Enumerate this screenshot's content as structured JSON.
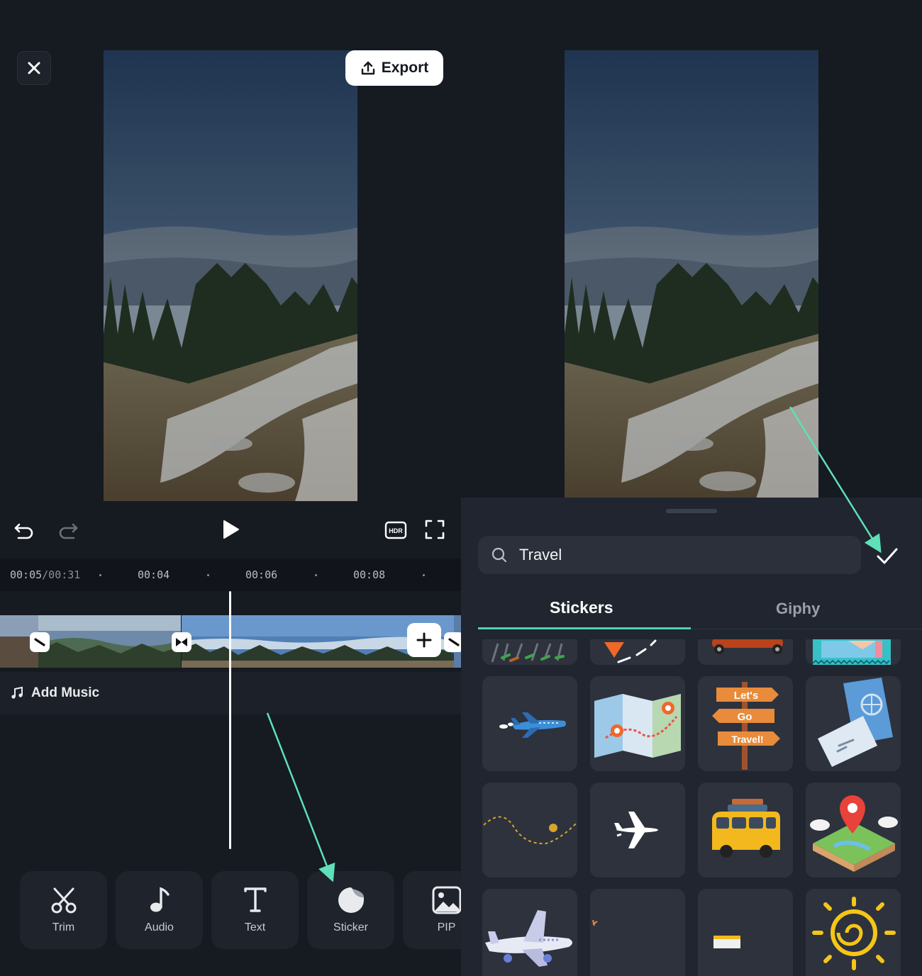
{
  "editor": {
    "export_label": "Export",
    "current_time": "00:05",
    "total_time": "/00:31",
    "ruler_marks": [
      "00:04",
      "00:06",
      "00:08"
    ],
    "add_music_label": "Add Music",
    "toolbar": [
      {
        "label": "Trim",
        "icon": "scissors-icon"
      },
      {
        "label": "Audio",
        "icon": "music-note-icon"
      },
      {
        "label": "Text",
        "icon": "text-icon"
      },
      {
        "label": "Sticker",
        "icon": "sticker-icon"
      },
      {
        "label": "PIP",
        "icon": "image-icon"
      }
    ]
  },
  "sticker_panel": {
    "search_value": "Travel",
    "tabs": [
      {
        "label": "Stickers",
        "active": true
      },
      {
        "label": "Giphy",
        "active": false
      }
    ],
    "sign_lines": [
      "Let's",
      "Go",
      "Travel!"
    ],
    "stickers": [
      "walking-feet-sticker",
      "map-pin-path-sticker",
      "car-sticker",
      "postage-stamp-sticker",
      "blue-airplane-sticker",
      "map-sticker",
      "lets-go-travel-sign-sticker",
      "passport-ticket-sticker",
      "dotted-path-sticker",
      "white-airplane-sticker",
      "yellow-van-sticker",
      "3d-map-pin-sticker",
      "3d-airplane-sticker",
      "blank-sticker",
      "small-tag-sticker",
      "sun-sticker"
    ]
  },
  "colors": {
    "background": "#161a21",
    "sheet": "#202530",
    "accent": "#4fd1b4",
    "annotation_arrow": "#5ee0b8"
  }
}
